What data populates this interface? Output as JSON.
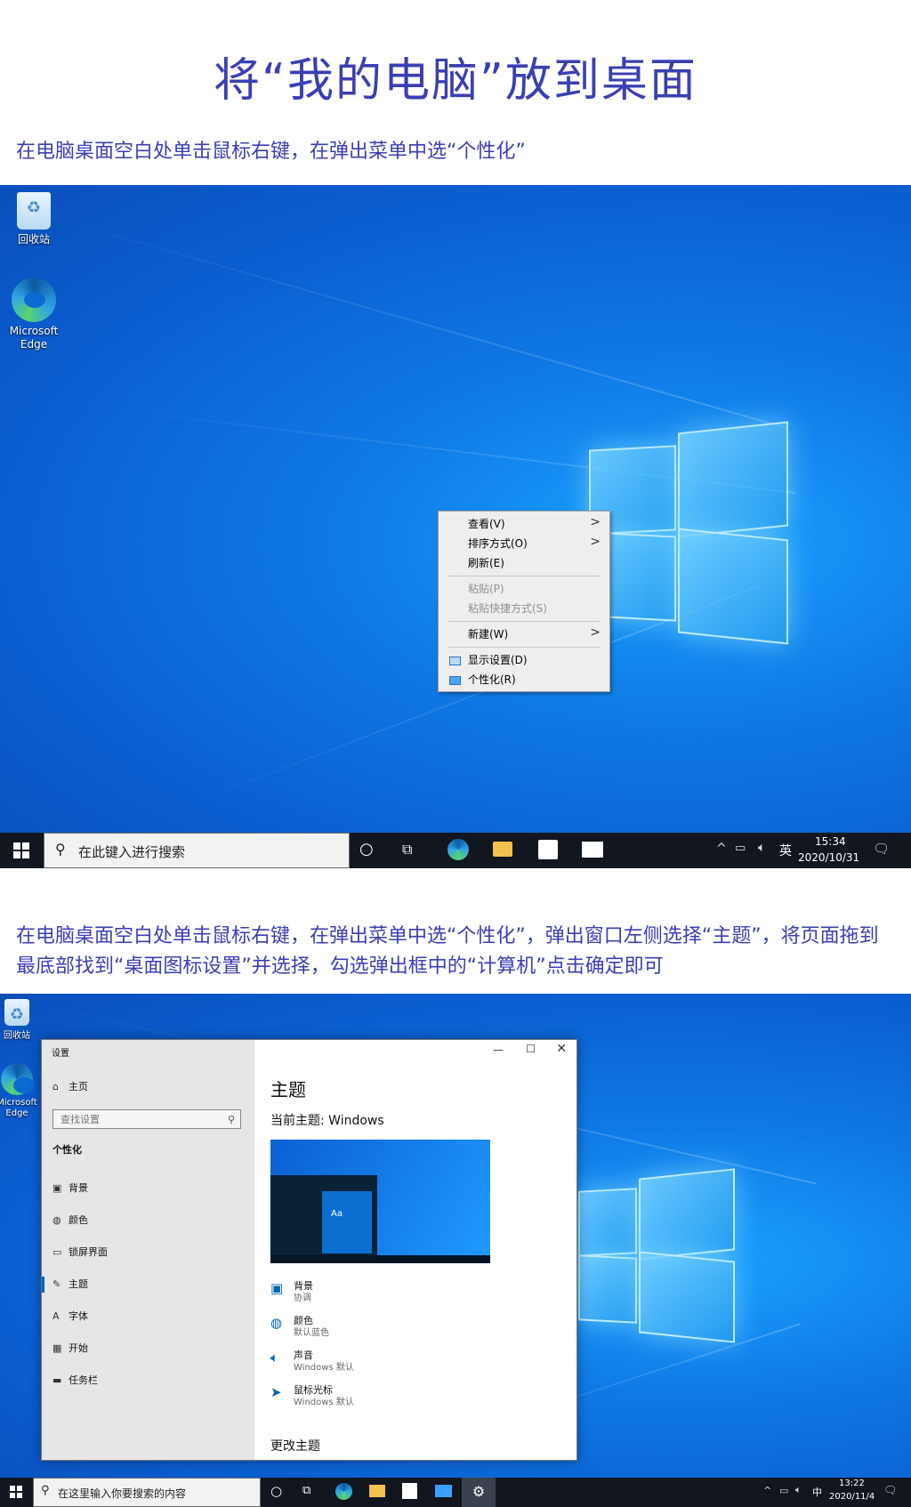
{
  "heading": "将“我的电脑”放到桌面",
  "step1": "在电脑桌面空白处单击鼠标右键，在弹出菜单中选“个性化”",
  "step2": "在电脑桌面空白处单击鼠标右键，在弹出菜单中选“个性化”，弹出窗口左侧选择“主题”，将页面拖到最底部找到“桌面图标设置”并选择，勾选弹出框中的“计算机”点击确定即可",
  "desktop_icons": {
    "recycle_bin": "回收站",
    "edge": "Microsoft Edge",
    "recycle_bin_small": "回收站",
    "edge_small": "Microsoft Edge"
  },
  "context_menu": {
    "items": [
      {
        "label": "查看(V)",
        "submenu": true
      },
      {
        "label": "排序方式(O)",
        "submenu": true
      },
      {
        "label": "刷新(E)"
      },
      {
        "label": "粘贴(P)",
        "disabled": true
      },
      {
        "label": "粘贴快捷方式(S)",
        "disabled": true
      },
      {
        "label": "新建(W)",
        "submenu": true
      },
      {
        "label": "显示设置(D)",
        "icon": "display-icon"
      },
      {
        "label": "个性化(R)",
        "icon": "personalize-icon"
      }
    ]
  },
  "taskbar1": {
    "search_placeholder": "在此键入进行搜索",
    "ime": "英",
    "time": "15:34",
    "date": "2020/10/31"
  },
  "taskbar2": {
    "search_placeholder": "在这里输入你要搜索的内容",
    "ime": "中",
    "time": "13:22",
    "date": "2020/11/4"
  },
  "settings": {
    "window_title": "设置",
    "home": "主页",
    "search_placeholder": "查找设置",
    "section": "个性化",
    "nav": [
      "背景",
      "颜色",
      "锁屏界面",
      "主题",
      "字体",
      "开始",
      "任务栏"
    ],
    "selected_nav": "主题",
    "page_title": "主题",
    "current_theme": "当前主题: Windows",
    "preview_tile": "Aa",
    "items": [
      {
        "title": "背景",
        "sub": "协调",
        "icon": "picture-icon"
      },
      {
        "title": "颜色",
        "sub": "默认蓝色",
        "icon": "palette-icon"
      },
      {
        "title": "声音",
        "sub": "Windows 默认",
        "icon": "speaker-icon"
      },
      {
        "title": "鼠标光标",
        "sub": "Windows 默认",
        "icon": "cursor-icon"
      }
    ],
    "change_theme": "更改主题"
  },
  "colors": {
    "accent_text": "#3a3fb3",
    "taskbar": "#11161f",
    "settings_accent": "#0063b1"
  }
}
